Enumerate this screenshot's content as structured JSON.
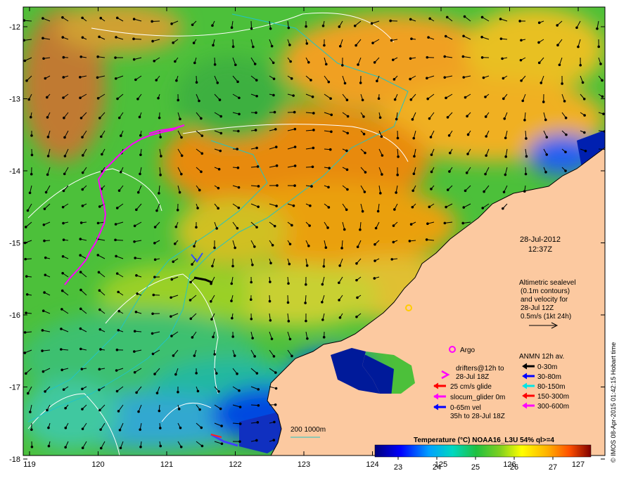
{
  "map": {
    "lon_ticks": [
      "119",
      "120",
      "121",
      "122",
      "123",
      "124",
      "125",
      "126",
      "127"
    ],
    "lat_ticks": [
      "-12",
      "-13",
      "-14",
      "-15",
      "-16",
      "-17",
      "-18"
    ]
  },
  "timestamp": {
    "date": "28-Jul-2012",
    "time": "12:37Z"
  },
  "altimetry": {
    "line1": "Altimetric sealevel",
    "line2": "(0.1m contours)",
    "line3": "and velocity for",
    "line4": "28-Jul 12Z",
    "line5": "0.5m/s (1kt 24h)"
  },
  "legend": {
    "argo": "Argo",
    "drifters_line1": "drifters@12h to",
    "drifters_line2": "28-Jul 18Z",
    "glide": "25 cm/s glide",
    "slocum": "slocum_glider 0m",
    "vel_line1": "0-65m vel",
    "vel_line2": "35h to 28-Jul 18Z",
    "anmn_title": "ANMN 12h av.",
    "anmn_items": [
      {
        "label": "0-30m",
        "color": "#000000"
      },
      {
        "label": "30-80m",
        "color": "#0000ff"
      },
      {
        "label": "80-150m",
        "color": "#00e5e5"
      },
      {
        "label": "150-300m",
        "color": "#ff0000"
      },
      {
        "label": "300-600m",
        "color": "#ff00ff"
      }
    ]
  },
  "bathy": {
    "label": "200  1000m"
  },
  "colorbar": {
    "title": "Temperature (°C) NOAA16_L3U 54% ql>=4",
    "ticks": [
      "23",
      "24",
      "25",
      "26",
      "27"
    ]
  },
  "credit": "© IMOS 08-Apr-2015 01:42:15 Hobart time",
  "colors": {
    "land": "#fcc9a0",
    "drifter": "#ff00ff",
    "contour": "#ffffff",
    "bathy": "#22c4c4"
  }
}
